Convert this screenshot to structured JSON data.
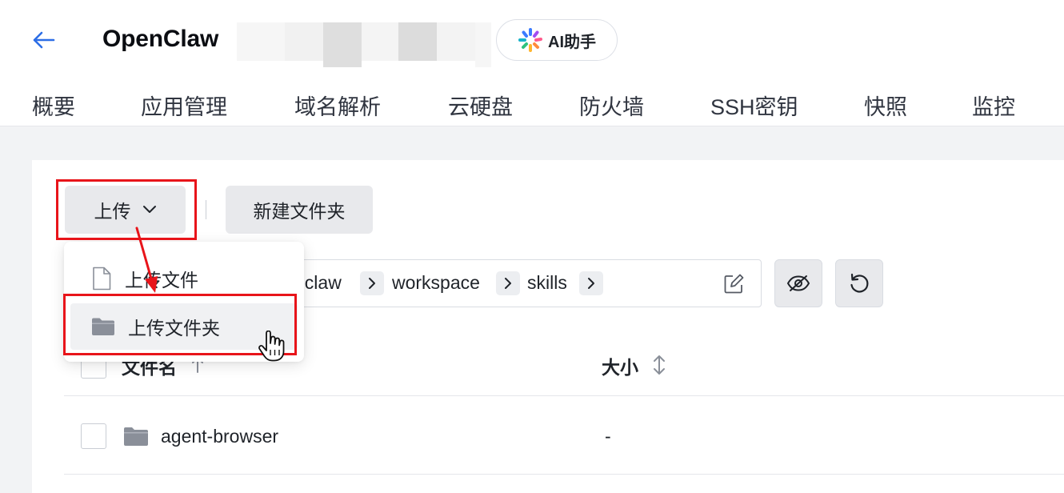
{
  "header": {
    "title": "OpenClaw",
    "ai_button_label": "AI助手",
    "tabs": [
      "概要",
      "应用管理",
      "域名解析",
      "云硬盘",
      "防火墙",
      "SSH密钥",
      "快照",
      "监控"
    ]
  },
  "toolbar": {
    "upload_label": "上传",
    "new_folder_label": "新建文件夹"
  },
  "upload_menu": {
    "items": [
      "上传文件",
      "上传文件夹"
    ]
  },
  "path": {
    "segments": [
      "nclaw",
      "workspace",
      "skills"
    ]
  },
  "table": {
    "headers": [
      "文件名",
      "大小"
    ],
    "rows": [
      {
        "name": "agent-browser",
        "size": "-"
      }
    ]
  },
  "colors": {
    "accent_blue": "#2d6ee6",
    "annotation_red": "#e8141a",
    "button_bg": "#e8e9ec",
    "folder_icon": "#8a8f99"
  }
}
